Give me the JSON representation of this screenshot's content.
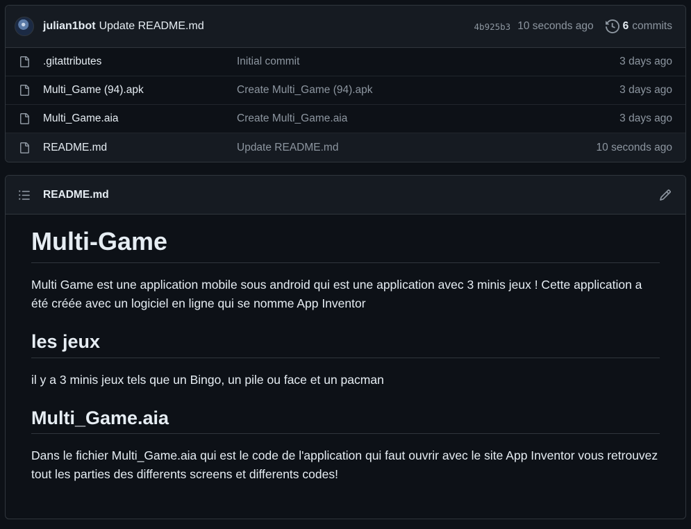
{
  "latest_commit": {
    "author": "julian1bot",
    "message": "Update README.md",
    "sha": "4b925b3",
    "time": "10 seconds ago",
    "commits_count": "6",
    "commits_label": "commits"
  },
  "files": [
    {
      "name": ".gitattributes",
      "commit": "Initial commit",
      "age": "3 days ago"
    },
    {
      "name": "Multi_Game (94).apk",
      "commit": "Create Multi_Game (94).apk",
      "age": "3 days ago"
    },
    {
      "name": "Multi_Game.aia",
      "commit": "Create Multi_Game.aia",
      "age": "3 days ago"
    },
    {
      "name": "README.md",
      "commit": "Update README.md",
      "age": "10 seconds ago"
    }
  ],
  "readme": {
    "filename": "README.md",
    "h1": "Multi-Game",
    "p1": "Multi Game est une application mobile sous android qui est une application avec 3 minis jeux ! Cette application a été créée avec un logiciel en ligne qui se nomme App Inventor",
    "h2_jeux": "les jeux",
    "p2": "il y a 3 minis jeux tels que un Bingo, un pile ou face et un pacman",
    "h2_aia": "Multi_Game.aia",
    "p3": "Dans le fichier Multi_Game.aia qui est le code de l'application qui faut ouvrir avec le site App Inventor vous retrouvez tout les parties des differents screens et differents codes!"
  },
  "icons": {
    "file": "file-icon",
    "history": "history-icon",
    "list": "list-unordered-icon",
    "edit": "pencil-icon"
  },
  "colors": {
    "background": "#0d1117",
    "header_bg": "#161b22",
    "border": "#30363d",
    "text": "#e6edf3",
    "muted": "#8d96a0"
  }
}
